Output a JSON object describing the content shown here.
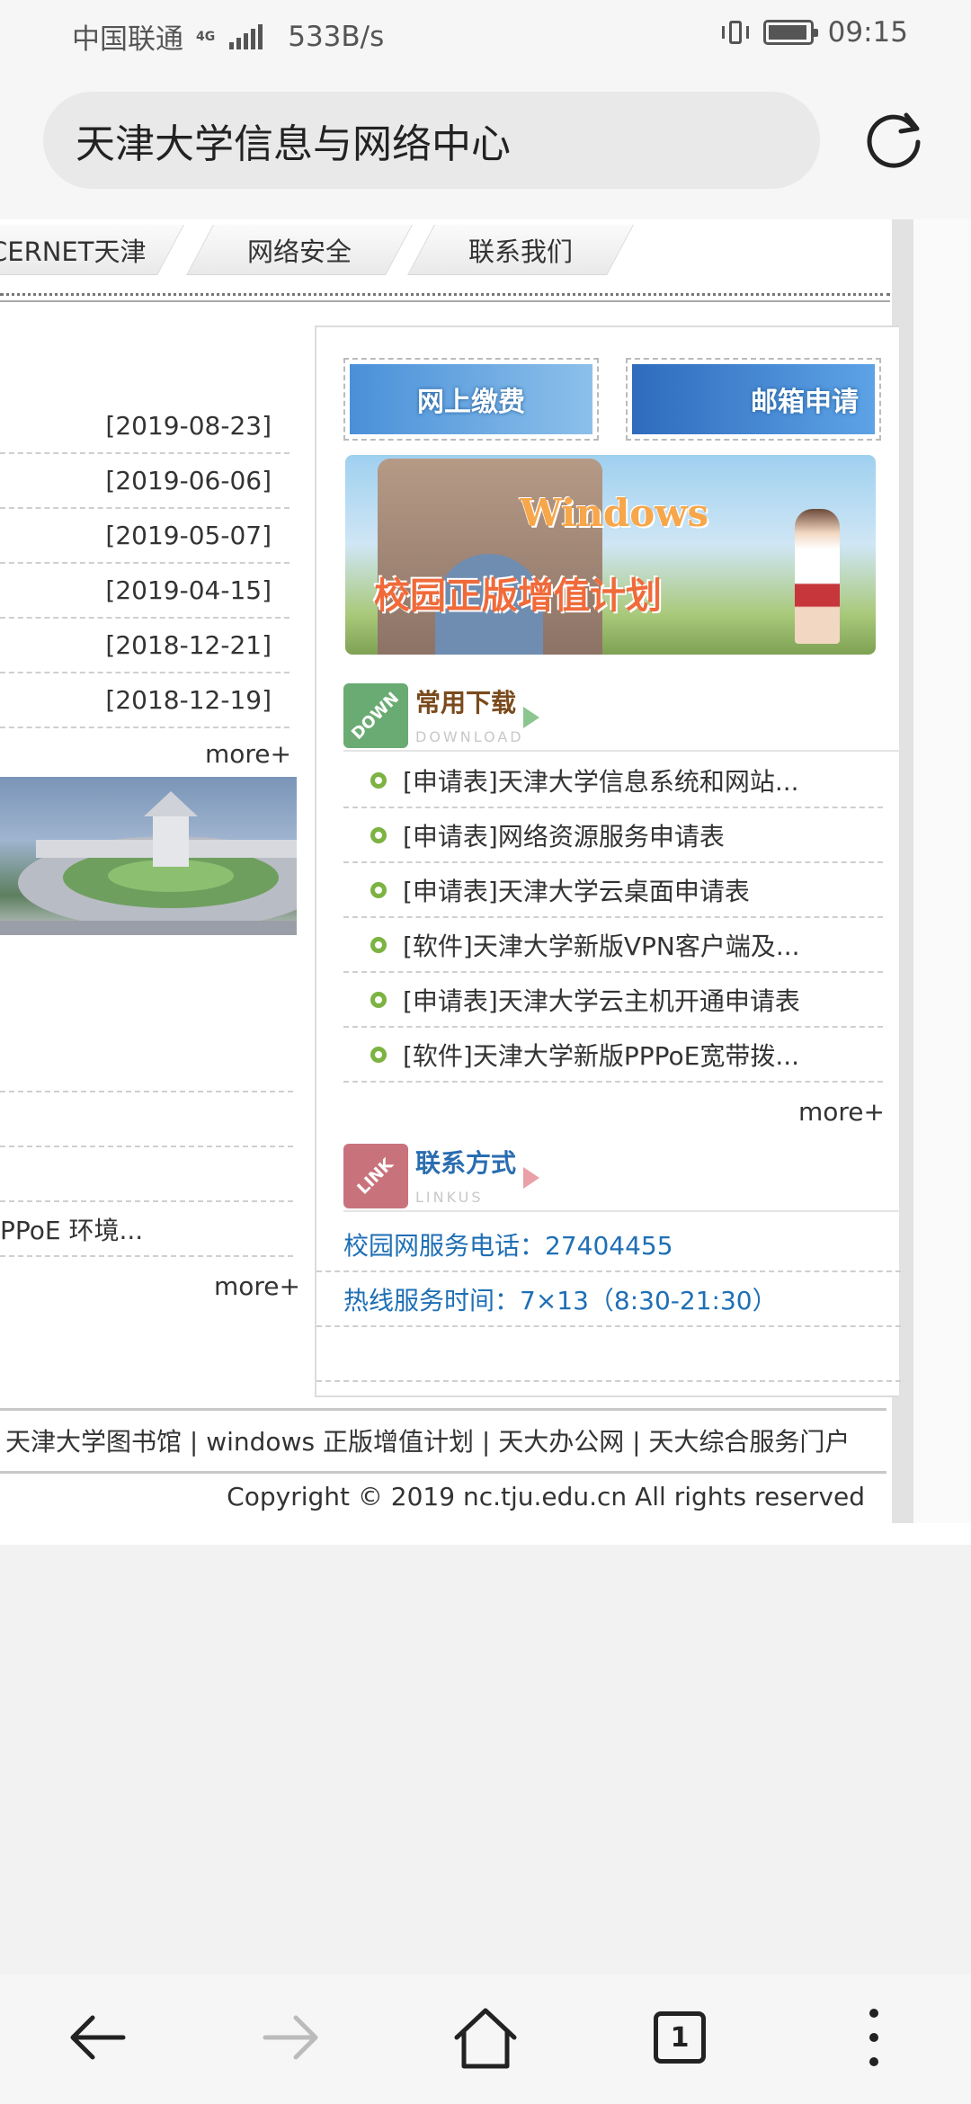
{
  "status_bar": {
    "carrier": "中国联通",
    "network": "4G",
    "speed": "533B/s",
    "time": "09:15"
  },
  "address_bar": {
    "title": "天津大学信息与网络中心"
  },
  "page": {
    "nav_tabs": [
      "CERNET天津",
      "网络安全",
      "联系我们"
    ],
    "news_dates": [
      "[2019-08-23]",
      "[2019-06-06]",
      "[2019-05-07]",
      "[2019-04-15]",
      "[2018-12-21]",
      "[2018-12-19]"
    ],
    "news_more": "more+",
    "news2_items": [
      "",
      "",
      "",
      "PPoE 环境..."
    ],
    "news2_more": "more+",
    "banners": {
      "pay": "网上缴费",
      "mail": "邮箱申请",
      "windows_en": "Windows",
      "windows_cn": "校园正版增值计划"
    },
    "downloads": {
      "icon_text": "DOWN",
      "title": "常用下载",
      "subtitle": "DOWNLOAD",
      "items": [
        "[申请表]天津大学信息系统和网站...",
        "[申请表]网络资源服务申请表",
        "[申请表]天津大学云桌面申请表",
        "[软件]天津大学新版VPN客户端及...",
        "[申请表]天津大学云主机开通申请表",
        "[软件]天津大学新版PPPoE宽带拨..."
      ],
      "more": "more+"
    },
    "contact": {
      "icon_text": "LINK",
      "title": "联系方式",
      "subtitle": "LINKUS",
      "phone": "校园网服务电话：27404455",
      "hours": "热线服务时间：7×13（8:30-21:30）"
    },
    "footer": {
      "links": "天津大学图书馆 | windows 正版增值计划 | 天大办公网 | 天大综合服务门户",
      "copyright": "Copyright © 2019 nc.tju.edu.cn All rights reserved"
    }
  },
  "bottom_nav": {
    "tab_count": "1"
  },
  "colors": {
    "link_blue": "#1f6fb5",
    "bullet_green": "#7cb342",
    "download_icon": "#6aab73",
    "link_icon": "#c8737c"
  }
}
